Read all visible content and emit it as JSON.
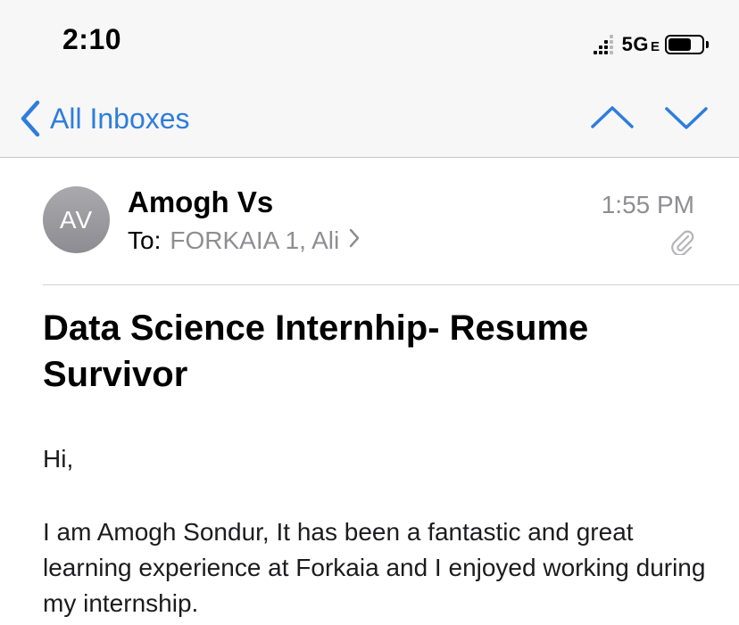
{
  "status_bar": {
    "time": "2:10",
    "network": "5G",
    "network_sub": "E",
    "battery_level": 0.7
  },
  "nav": {
    "back_label": "All Inboxes",
    "accent_color": "#2f7ddb",
    "icons": [
      "chevron-left-icon",
      "chevron-up-icon",
      "chevron-down-icon"
    ]
  },
  "message": {
    "avatar_initials": "AV",
    "sender": "Amogh Vs",
    "to_label": "To:",
    "to_names": "FORKAIA 1, Ali",
    "time": "1:55 PM",
    "has_attachment": true,
    "subject": "Data Science Internhip- Resume Survivor",
    "greeting": "Hi,",
    "body": "I am Amogh Sondur, It has been a fantastic and great learning experience at Forkaia and I enjoyed working during my internship."
  }
}
